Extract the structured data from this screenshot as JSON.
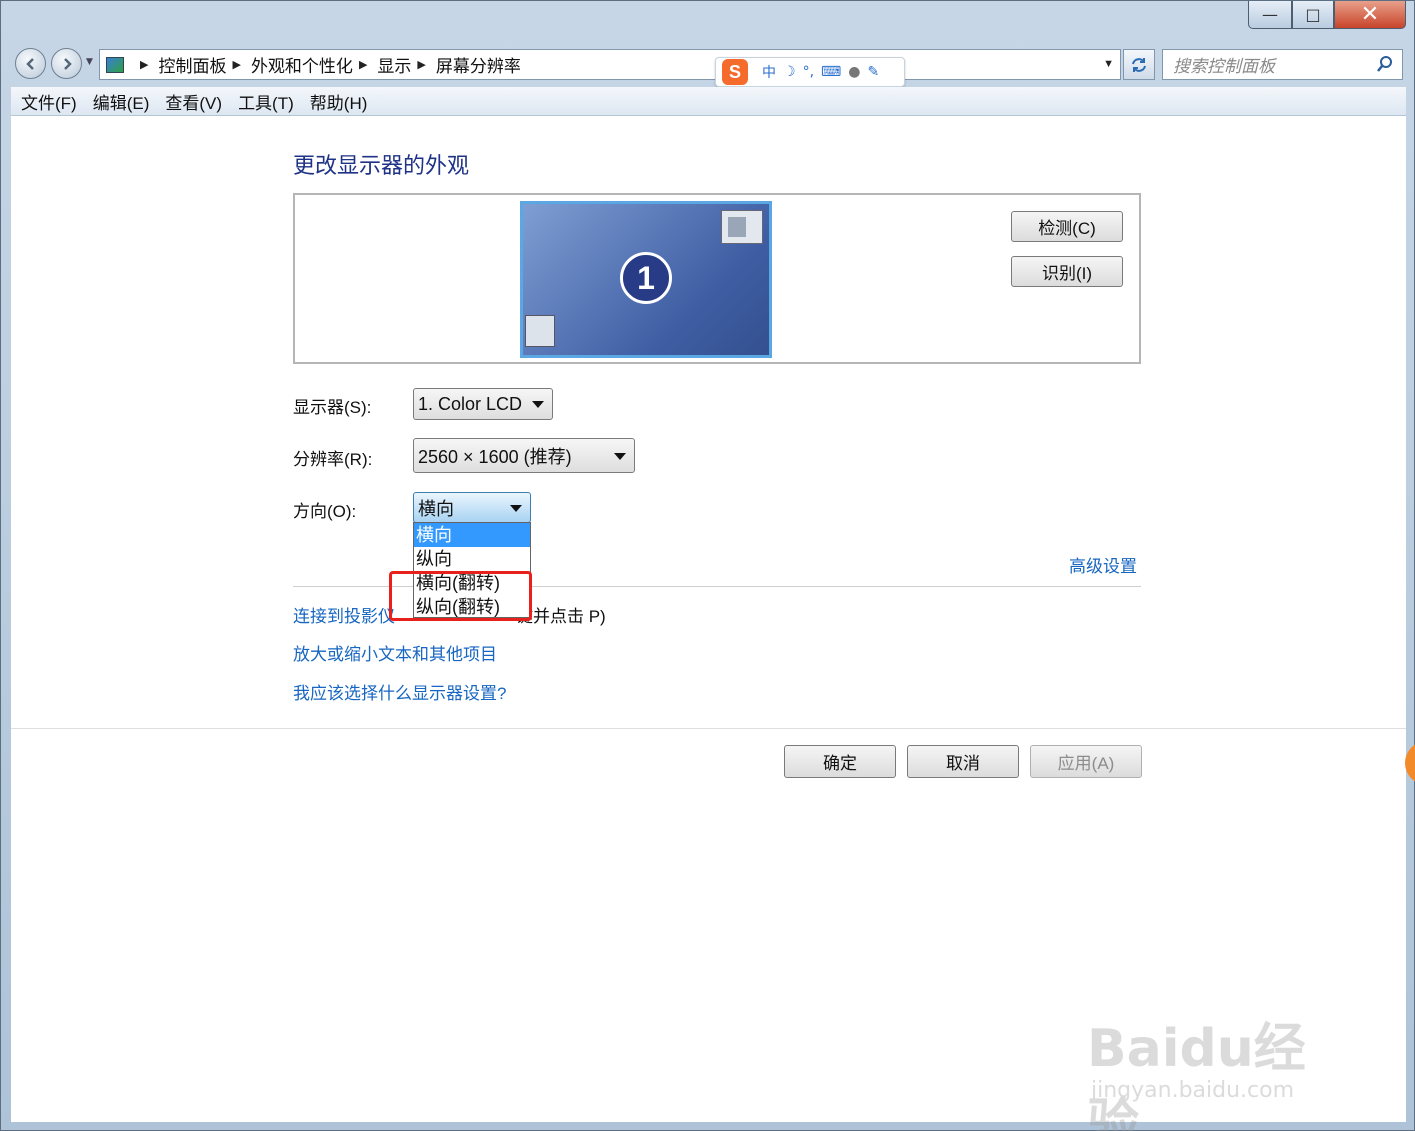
{
  "window": {
    "minimize_symbol": "—",
    "maximize_symbol": "□",
    "close_symbol": "✕"
  },
  "address": {
    "breadcrumbs": [
      "控制面板",
      "外观和个性化",
      "显示",
      "屏幕分辨率"
    ],
    "search_placeholder": "搜索控制面板"
  },
  "ime": {
    "logo": "S",
    "mode": "中"
  },
  "menu": [
    "文件(F)",
    "编辑(E)",
    "查看(V)",
    "工具(T)",
    "帮助(H)"
  ],
  "page": {
    "title": "更改显示器的外观",
    "monitor_number": "1",
    "detect_button": "检测(C)",
    "identify_button": "识别(I)",
    "display_label": "显示器(S):",
    "display_value": "1. Color LCD",
    "resolution_label": "分辨率(R):",
    "resolution_value": "2560 × 1600 (推荐)",
    "orientation_label": "方向(O):",
    "orientation_value": "横向",
    "orientation_options": [
      "横向",
      "纵向",
      "横向(翻转)",
      "纵向(翻转)"
    ],
    "advanced_link": "高级设置",
    "projector_link": "连接到投影仪",
    "projector_hint": "键并点击 P)",
    "zoom_link": "放大或缩小文本和其他项目",
    "help_link": "我应该选择什么显示器设置?"
  },
  "footer": {
    "ok": "确定",
    "cancel": "取消",
    "apply": "应用(A)"
  },
  "watermark": {
    "brand": "Baidu经验",
    "url": "jingyan.baidu.com"
  },
  "colors": {
    "link": "#1766c1",
    "title": "#1e3287",
    "highlight": "#e8211c",
    "selection": "#3399ff"
  }
}
